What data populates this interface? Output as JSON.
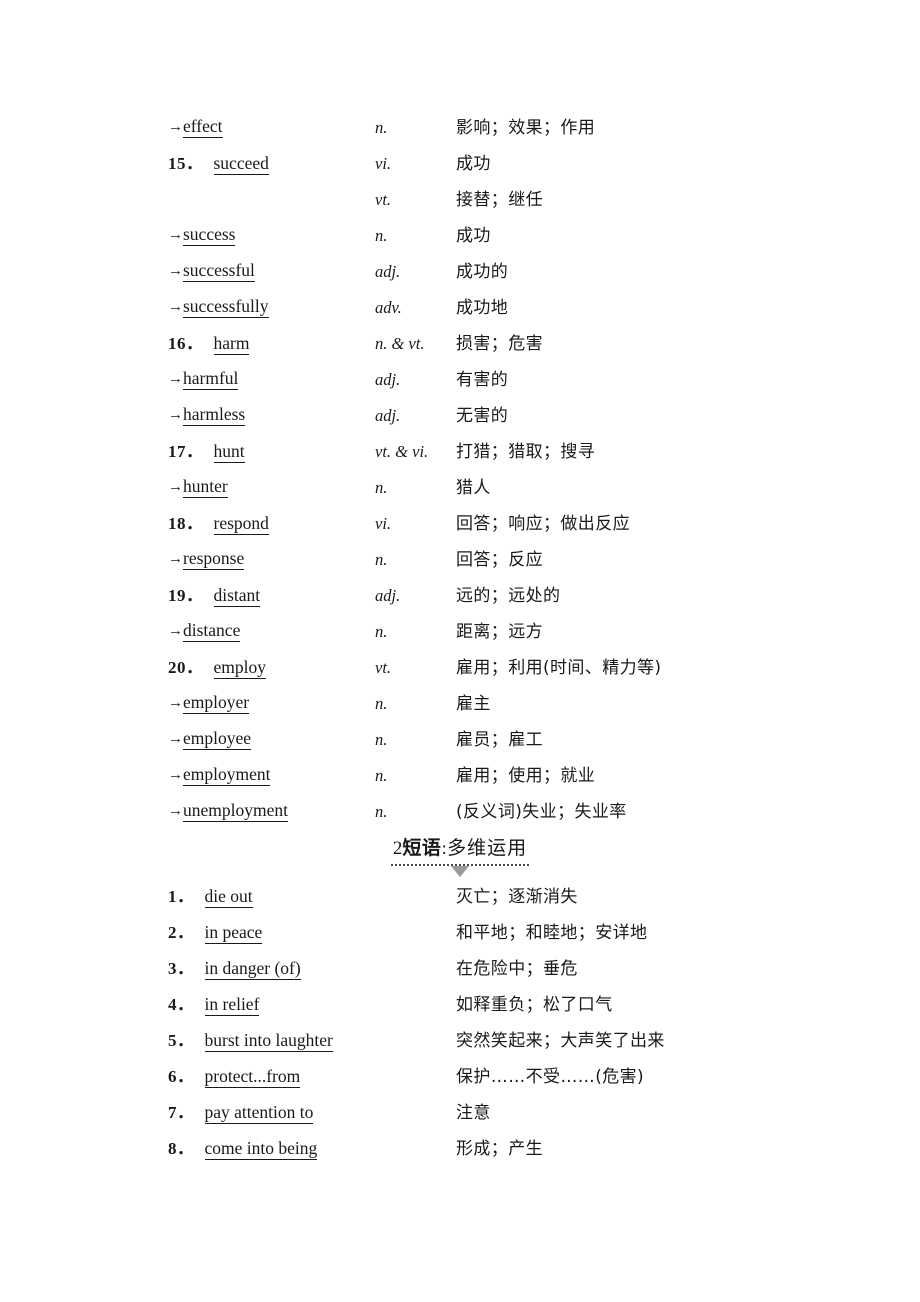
{
  "page": {
    "background": "#ffffff",
    "text_color": "#1a1a1a",
    "accent_gray": "#9a9a9a"
  },
  "word_list": {
    "columns": [
      "term",
      "part_of_speech",
      "definition"
    ],
    "rows": [
      {
        "marker_type": "arrow",
        "marker": "→",
        "number": "",
        "term": "effect",
        "pos": "n.",
        "def": "影响；效果；作用"
      },
      {
        "marker_type": "number",
        "marker": "",
        "number": "15",
        "term": "succeed",
        "pos": "vi.",
        "def": "成功"
      },
      {
        "marker_type": "none",
        "marker": "",
        "number": "",
        "term": "",
        "pos": "vt.",
        "def": "接替；继任"
      },
      {
        "marker_type": "arrow",
        "marker": "→",
        "number": "",
        "term": "success",
        "pos": "n.",
        "def": "成功"
      },
      {
        "marker_type": "arrow",
        "marker": "→",
        "number": "",
        "term": "successful",
        "pos": "adj.",
        "def": "成功的"
      },
      {
        "marker_type": "arrow",
        "marker": "→",
        "number": "",
        "term": "successfully",
        "pos": "adv.",
        "def": "成功地"
      },
      {
        "marker_type": "number",
        "marker": "",
        "number": "16",
        "term": "harm",
        "pos": "n. & vt.",
        "def": "损害；危害"
      },
      {
        "marker_type": "arrow",
        "marker": "→",
        "number": "",
        "term": "harmful",
        "pos": "adj.",
        "def": "有害的"
      },
      {
        "marker_type": "arrow",
        "marker": "→",
        "number": "",
        "term": "harmless",
        "pos": "adj.",
        "def": "无害的"
      },
      {
        "marker_type": "number",
        "marker": "",
        "number": "17",
        "term": "hunt",
        "pos": "vt. & vi.",
        "def": "打猎；猎取；搜寻"
      },
      {
        "marker_type": "arrow",
        "marker": "→",
        "number": "",
        "term": "hunter",
        "pos": "n.",
        "def": "猎人"
      },
      {
        "marker_type": "number",
        "marker": "",
        "number": "18",
        "term": "respond",
        "pos": "vi.",
        "def": "回答；响应；做出反应"
      },
      {
        "marker_type": "arrow",
        "marker": "→",
        "number": "",
        "term": "response",
        "pos": "n.",
        "def": "回答；反应"
      },
      {
        "marker_type": "number",
        "marker": "",
        "number": "19",
        "term": "distant",
        "pos": "adj.",
        "def": "远的；远处的"
      },
      {
        "marker_type": "arrow",
        "marker": "→",
        "number": "",
        "term": "distance",
        "pos": "n.",
        "def": "距离；远方"
      },
      {
        "marker_type": "number",
        "marker": "",
        "number": "20",
        "term": "employ",
        "pos": "vt.",
        "def": "雇用；利用(时间、精力等)"
      },
      {
        "marker_type": "arrow",
        "marker": "→",
        "number": "",
        "term": "employer",
        "pos": "n.",
        "def": "雇主"
      },
      {
        "marker_type": "arrow",
        "marker": "→",
        "number": "",
        "term": "employee",
        "pos": "n.",
        "def": "雇员；雇工"
      },
      {
        "marker_type": "arrow",
        "marker": "→",
        "number": "",
        "term": "employment",
        "pos": "n.",
        "def": "雇用；使用；就业"
      },
      {
        "marker_type": "arrow",
        "marker": "→",
        "number": "",
        "term": "unemployment",
        "pos": "n.",
        "def": "(反义词)失业；失业率"
      }
    ]
  },
  "section_header": {
    "number": "2",
    "bold_label": "短语",
    "colon": ":",
    "rest": "多维运用",
    "full_text": "2短语:多维运用",
    "has_dotted_underline": true,
    "triangle_color": "#9a9a9a"
  },
  "phrase_list": {
    "columns": [
      "phrase",
      "definition"
    ],
    "rows": [
      {
        "number": "1",
        "term": "die out",
        "def": "灭亡；逐渐消失"
      },
      {
        "number": "2",
        "term": "in peace",
        "def": "和平地；和睦地；安详地"
      },
      {
        "number": "3",
        "term": "in danger (of)",
        "def": "在危险中；垂危"
      },
      {
        "number": "4",
        "term": "in relief",
        "def": "如释重负；松了口气"
      },
      {
        "number": "5",
        "term": "burst into laughter",
        "def": "突然笑起来；大声笑了出来"
      },
      {
        "number": "6",
        "term": "protect...from",
        "def": "保护……不受……(危害)"
      },
      {
        "number": "7",
        "term": "pay attention to",
        "def": "注意"
      },
      {
        "number": "8",
        "term": "come into being",
        "def": "形成；产生"
      }
    ]
  }
}
